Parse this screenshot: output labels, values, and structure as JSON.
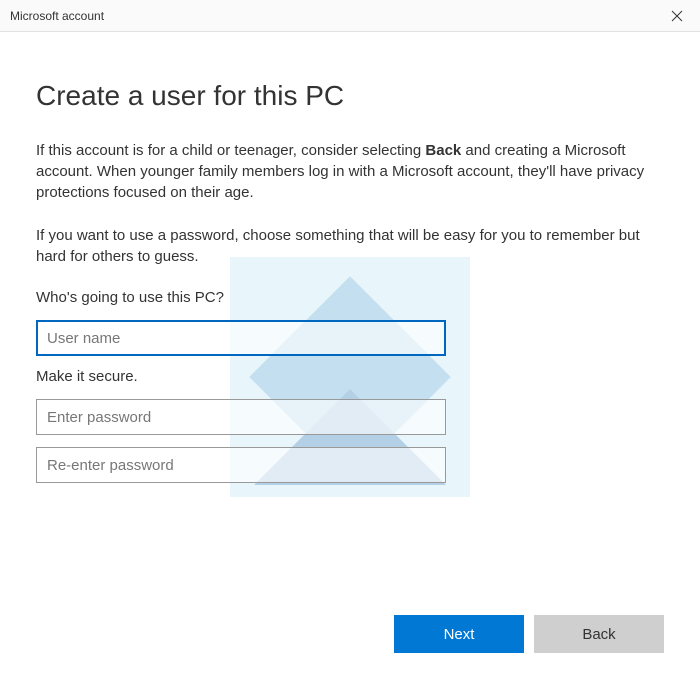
{
  "titlebar": {
    "title": "Microsoft account"
  },
  "heading": "Create a user for this PC",
  "paragraph1_pre": "If this account is for a child or teenager, consider selecting ",
  "paragraph1_bold": "Back",
  "paragraph1_post": " and creating a Microsoft account. When younger family members log in with a Microsoft account, they'll have privacy protections focused on their age.",
  "paragraph2": "If you want to use a password, choose something that will be easy for you to remember but hard for others to guess.",
  "who_label": "Who's going to use this PC?",
  "username_placeholder": "User name",
  "secure_label": "Make it secure.",
  "password_placeholder": "Enter password",
  "repassword_placeholder": "Re-enter password",
  "buttons": {
    "next": "Next",
    "back": "Back"
  }
}
